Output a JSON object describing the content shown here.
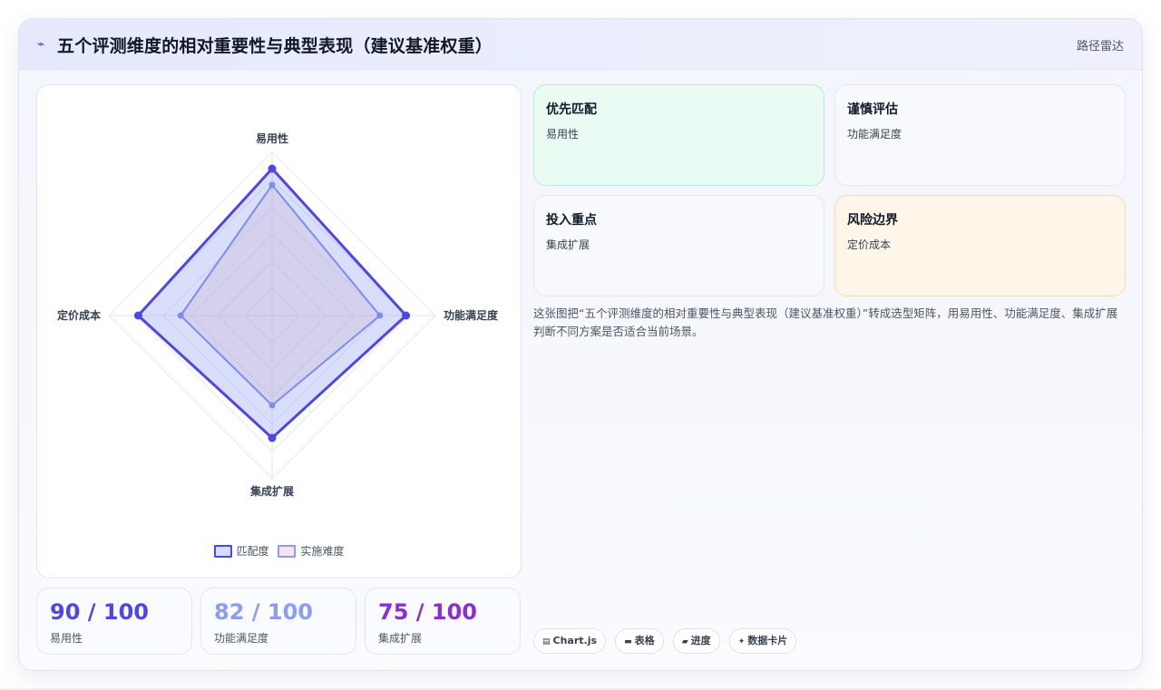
{
  "header": {
    "icon": "bolt-icon",
    "title": "五个评测维度的相对重要性与典型表现（建议基准权重）",
    "tag": "路径雷达"
  },
  "chart_data": {
    "type": "radar",
    "axes": [
      "易用性",
      "功能满足度",
      "集成扩展",
      "定价成本"
    ],
    "rmax": 100,
    "series": [
      {
        "name": "匹配度",
        "values": [
          90,
          82,
          75,
          82
        ],
        "color": "#4f46e5",
        "fill": "rgba(120,140,240,0.28)"
      },
      {
        "name": "实施难度",
        "values": [
          80,
          66,
          55,
          56
        ],
        "color": "#7d8ef0",
        "fill": "rgba(235,200,200,0.35)"
      }
    ],
    "grid": "on",
    "legend": "bottom"
  },
  "metrics": [
    {
      "value": "90 / 100",
      "label": "易用性",
      "color": "#4f46e5"
    },
    {
      "value": "82 / 100",
      "label": "功能满足度",
      "color": "#8b9cf2"
    },
    {
      "value": "75 / 100",
      "label": "集成扩展",
      "color": "#8b2fd1"
    }
  ],
  "quadrants": [
    {
      "title": "优先匹配",
      "value": "易用性"
    },
    {
      "title": "谨慎评估",
      "value": "功能满足度"
    },
    {
      "title": "投入重点",
      "value": "集成扩展"
    },
    {
      "title": "风险边界",
      "value": "定价成本"
    }
  ],
  "description": "这张图把“五个评测维度的相对重要性与典型表现（建议基准权重）”转成选型矩阵，用易用性、功能满足度、集成扩展判断不同方案是否适合当前场景。",
  "chips": [
    {
      "icon": "chart-icon",
      "label": "Chart.js"
    },
    {
      "icon": "table-icon",
      "label": "表格"
    },
    {
      "icon": "progress-icon",
      "label": "进度"
    },
    {
      "icon": "data-card-icon",
      "label": "数据卡片"
    }
  ]
}
